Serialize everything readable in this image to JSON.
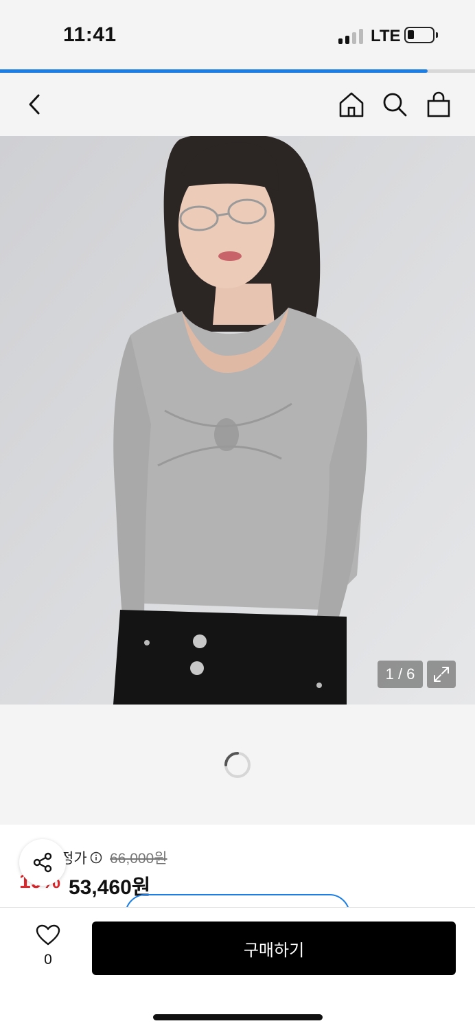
{
  "status_bar": {
    "time": "11:41",
    "network": "LTE",
    "signal_bars_active": 2,
    "signal_bars_total": 4,
    "battery_level": 0.22
  },
  "page_load_progress": 0.9,
  "nav": {
    "back_icon": "chevron-left-icon",
    "home_icon": "home-icon",
    "search_icon": "search-icon",
    "cart_icon": "shopping-bag-icon"
  },
  "gallery": {
    "counter": "1 / 6",
    "expand_icon": "expand-icon"
  },
  "product": {
    "price_label": "정가",
    "original_price": "66,000원",
    "discount": "19%",
    "sale_price": "53,460원"
  },
  "actions": {
    "like_count": "0",
    "buy_label": "구매하기"
  },
  "colors": {
    "accent": "#1b7ee6",
    "discount": "#e0262a",
    "buy_button": "#000000"
  }
}
